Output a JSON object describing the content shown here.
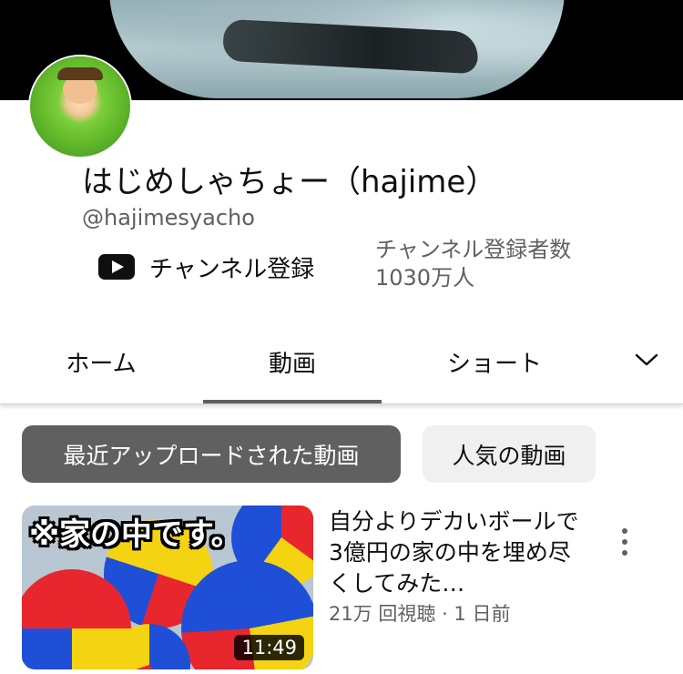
{
  "channel": {
    "name": "はじめしゃちょー（hajime）",
    "handle": "@hajimesyacho",
    "subscribe_label": "チャンネル登録",
    "subscriber_label": "チャンネル登録者数",
    "subscriber_count": "1030万人"
  },
  "tabs": [
    {
      "label": "ホーム",
      "active": false
    },
    {
      "label": "動画",
      "active": true
    },
    {
      "label": "ショート",
      "active": false
    }
  ],
  "filters": [
    {
      "label": "最近アップロードされた動画",
      "selected": true
    },
    {
      "label": "人気の動画",
      "selected": false
    }
  ],
  "videos": [
    {
      "thumbnail_caption": "※家の中です。",
      "duration": "11:49",
      "title": "自分よりデカいボールで3億円の家の中を埋め尽くしてみた…",
      "meta": "21万 回視聴 · 1 日前"
    }
  ],
  "icons": {
    "subscribe": "youtube-play-icon",
    "tabs_more": "chevron-down-icon",
    "video_menu": "more-vertical-icon"
  },
  "colors": {
    "youtube_black": "#0f0f0f",
    "selected_chip": "#606060",
    "secondary_text": "#606060"
  }
}
